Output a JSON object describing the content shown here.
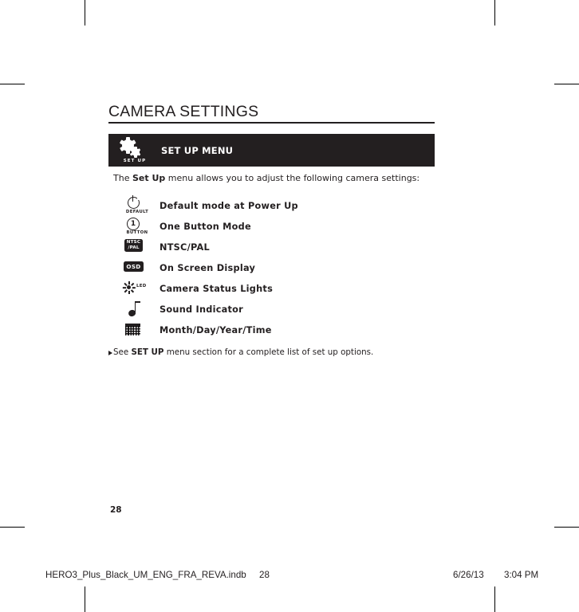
{
  "page": {
    "title": "CAMERA SETTINGS",
    "folio": "28"
  },
  "banner": {
    "icon_name": "set-up-gears-icon",
    "icon_caption": "SET UP",
    "title": "SET UP MENU"
  },
  "intro": {
    "before": "The ",
    "bold": "Set Up",
    "after": " menu allows you to adjust the following camera settings:"
  },
  "settings": [
    {
      "icon": "power-default-icon",
      "icon_caption": "DEFAULT",
      "label": "Default mode at Power Up"
    },
    {
      "icon": "one-button-icon",
      "icon_caption": "BUTTON",
      "icon_text": "1",
      "label": "One Button Mode"
    },
    {
      "icon": "ntsc-pal-icon",
      "icon_line1": "NTSC",
      "icon_line2": "/PAL",
      "label": "NTSC/PAL"
    },
    {
      "icon": "osd-icon",
      "icon_text": "OSD",
      "label": "On Screen Display"
    },
    {
      "icon": "led-status-icon",
      "icon_text": "LED",
      "label": "Camera Status Lights"
    },
    {
      "icon": "sound-note-icon",
      "label": "Sound Indicator"
    },
    {
      "icon": "calendar-grid-icon",
      "label": "Month/Day/Year/Time"
    }
  ],
  "see_note": {
    "before": "See ",
    "bold": "SET UP",
    "after": " menu section for a complete list of set up options."
  },
  "doc_footer": {
    "file": "HERO3_Plus_Black_UM_ENG_FRA_REVA.indb",
    "page": "28",
    "date": "6/26/13",
    "time": "3:04 PM"
  },
  "colors": {
    "ink": "#231f20",
    "paper": "#ffffff",
    "banner_bg": "#231f20"
  }
}
